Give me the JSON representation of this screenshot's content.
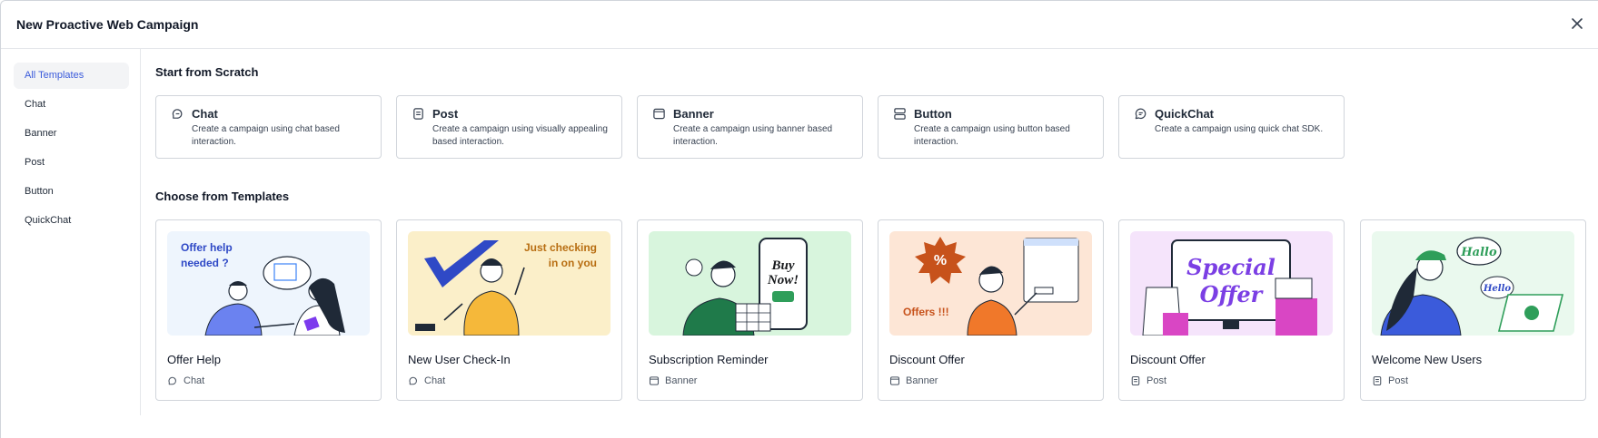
{
  "dialog": {
    "title": "New Proactive Web Campaign",
    "close_icon": "close-icon"
  },
  "sidebar": {
    "items": [
      {
        "label": "All Templates",
        "active": true
      },
      {
        "label": "Chat"
      },
      {
        "label": "Banner"
      },
      {
        "label": "Post"
      },
      {
        "label": "Button"
      },
      {
        "label": "QuickChat"
      }
    ]
  },
  "scratch": {
    "title": "Start from Scratch",
    "cards": [
      {
        "title": "Chat",
        "desc": "Create a campaign using chat based interaction.",
        "icon": "chat-icon"
      },
      {
        "title": "Post",
        "desc": "Create a campaign using visually appealing based interaction.",
        "icon": "post-icon"
      },
      {
        "title": "Banner",
        "desc": "Create a campaign using banner based interaction.",
        "icon": "banner-icon"
      },
      {
        "title": "Button",
        "desc": "Create a campaign using button based interaction.",
        "icon": "button-icon"
      },
      {
        "title": "QuickChat",
        "desc": "Create a campaign using quick chat SDK.",
        "icon": "quickchat-icon"
      }
    ]
  },
  "templates": {
    "title": "Choose from Templates",
    "cards": [
      {
        "name": "Offer Help",
        "type": "Chat",
        "icon": "chat-icon",
        "overlay": "Offer help needed ?",
        "bg": "#eef5fd",
        "accent": "#2f49c6"
      },
      {
        "name": "New User Check-In",
        "type": "Chat",
        "icon": "chat-icon",
        "overlay": "Just checking in on you",
        "bg": "#fbefc9",
        "accent": "#b86e12"
      },
      {
        "name": "Subscription Reminder",
        "type": "Banner",
        "icon": "banner-icon",
        "overlay": "Buy Now!",
        "bg": "#d8f5dd",
        "accent": "#17191c"
      },
      {
        "name": "Discount Offer",
        "type": "Banner",
        "icon": "banner-icon",
        "overlay": "Offers !!!",
        "bg": "#fde6d6",
        "accent": "#c7521b"
      },
      {
        "name": "Discount Offer",
        "type": "Post",
        "icon": "post-icon",
        "overlay": "Special Offer",
        "bg": "#f5e4fb",
        "accent": "#7b3fe4"
      },
      {
        "name": "Welcome New Users",
        "type": "Post",
        "icon": "post-icon",
        "overlay": "Hallo",
        "bg": "#eaf9ee",
        "accent": "#2f9e5a"
      }
    ]
  }
}
